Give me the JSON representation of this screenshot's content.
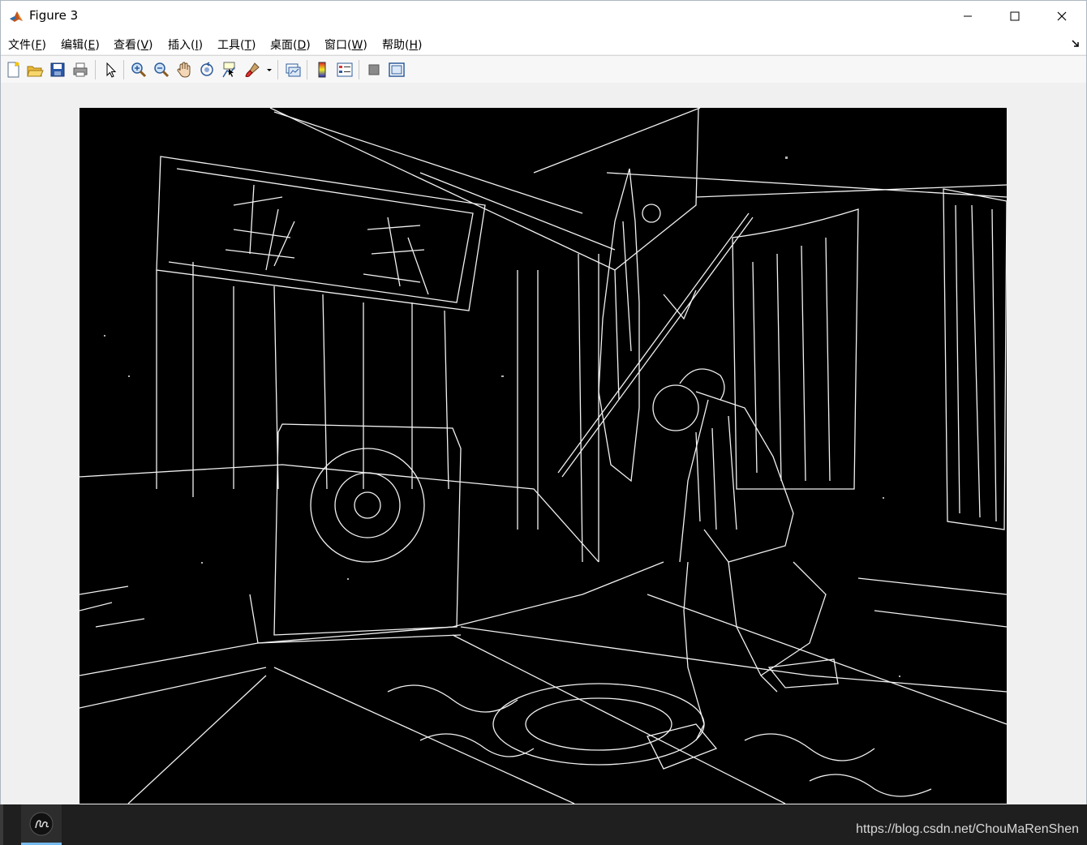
{
  "window": {
    "title": "Figure 3",
    "controls": {
      "minimize": "minimize-icon",
      "maximize": "maximize-icon",
      "close": "close-icon"
    }
  },
  "menubar": {
    "items": [
      {
        "label": "文件(",
        "key": "F",
        "suffix": ")"
      },
      {
        "label": "编辑(",
        "key": "E",
        "suffix": ")"
      },
      {
        "label": "查看(",
        "key": "V",
        "suffix": ")"
      },
      {
        "label": "插入(",
        "key": "I",
        "suffix": ")"
      },
      {
        "label": "工具(",
        "key": "T",
        "suffix": ")"
      },
      {
        "label": "桌面(",
        "key": "D",
        "suffix": ")"
      },
      {
        "label": "窗口(",
        "key": "W",
        "suffix": ")"
      },
      {
        "label": "帮助(",
        "key": "H",
        "suffix": ")"
      }
    ]
  },
  "toolbar": {
    "buttons": [
      "new-figure-icon",
      "open-file-icon",
      "save-icon",
      "print-icon",
      "pointer-icon",
      "zoom-in-icon",
      "zoom-out-icon",
      "pan-hand-icon",
      "rotate-3d-icon",
      "data-cursor-icon",
      "brush-icon",
      "link-plot-icon",
      "colorbar-icon",
      "legend-icon",
      "hide-plot-tools-icon",
      "show-plot-tools-icon"
    ]
  },
  "figure": {
    "image_type": "edge-detection-binary-image",
    "colors": {
      "background": "#000000",
      "edges": "#ffffff"
    }
  },
  "taskbar": {
    "app_icon": "app-signature-icon",
    "watermark": "https://blog.csdn.net/ChouMaRenShen"
  }
}
